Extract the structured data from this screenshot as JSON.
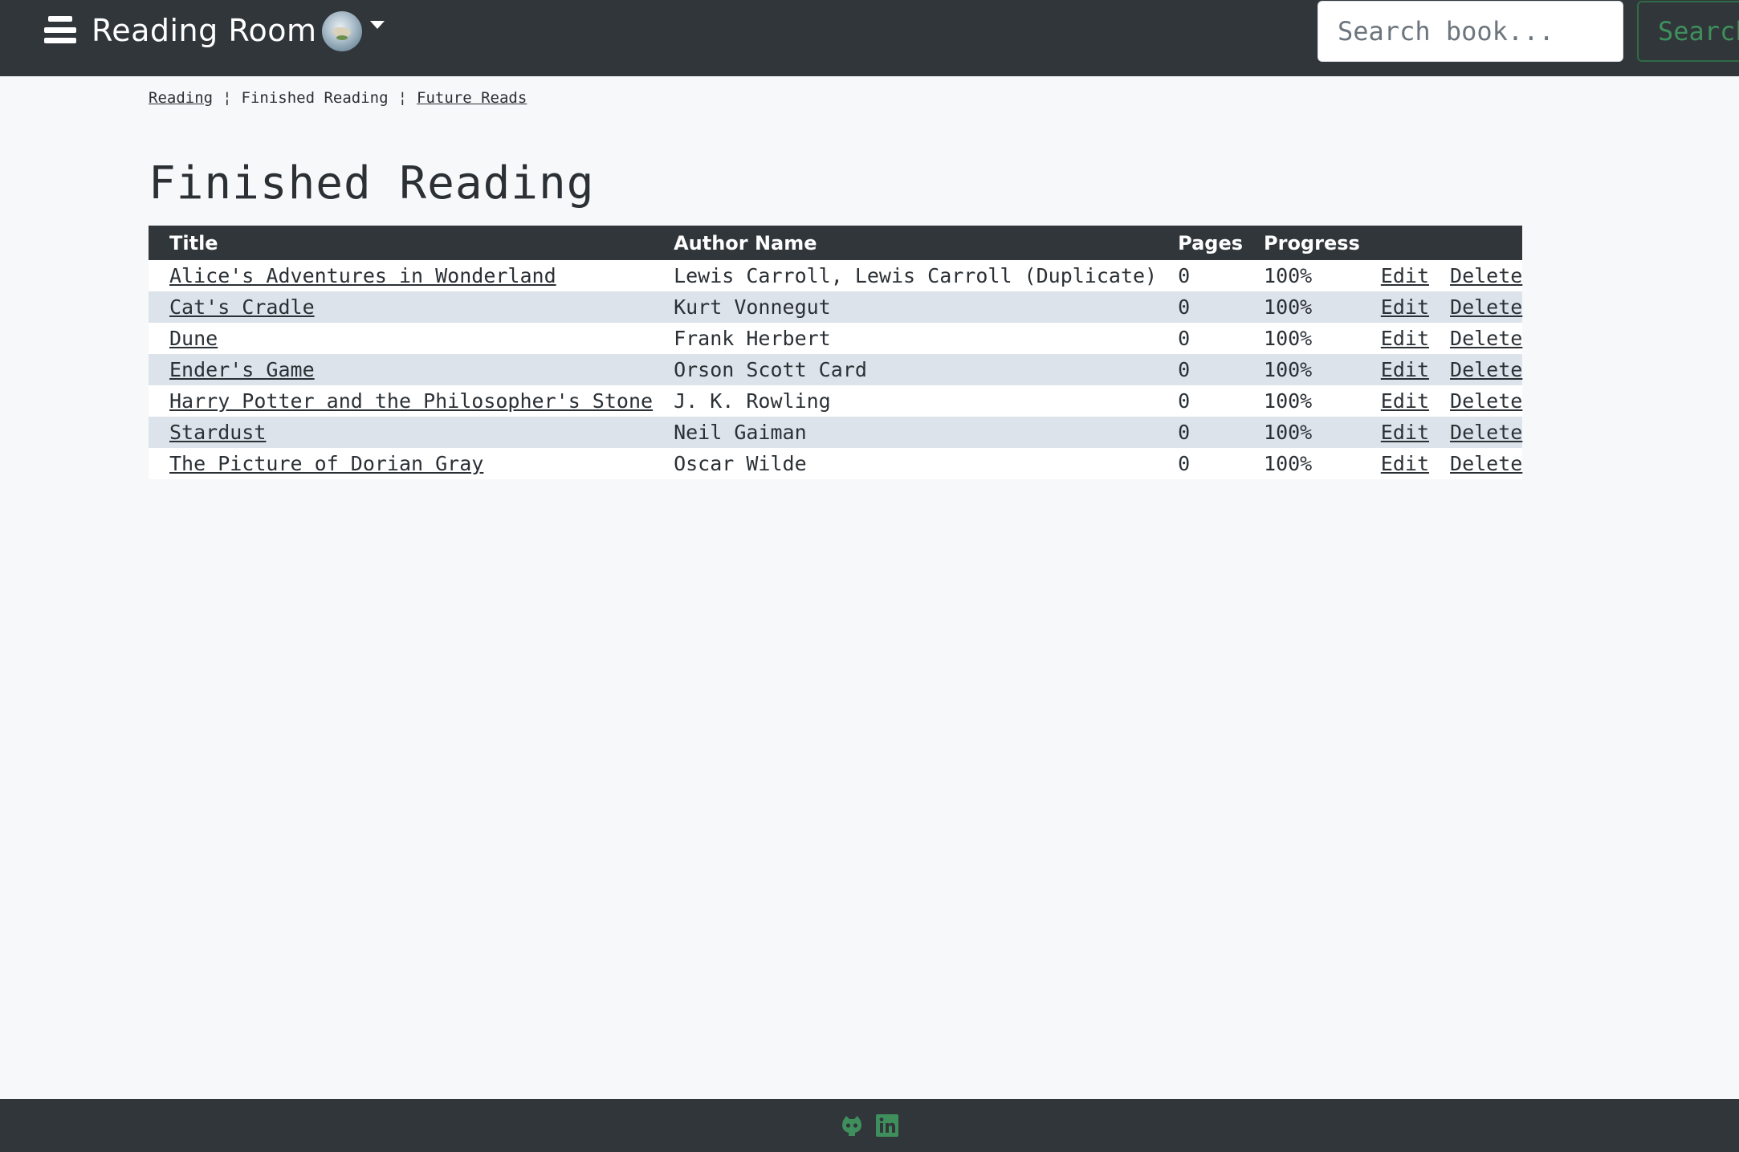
{
  "navbar": {
    "brand": "Reading Room",
    "search_placeholder": "Search book...",
    "search_button": "Search"
  },
  "breadcrumb": {
    "reading": "Reading",
    "separator": "¦",
    "finished": "Finished Reading",
    "future": "Future Reads"
  },
  "page_title": "Finished Reading",
  "table": {
    "headers": {
      "title": "Title",
      "author": "Author Name",
      "pages": "Pages",
      "progress": "Progress"
    },
    "rows": [
      {
        "title": "Alice's Adventures in Wonderland",
        "author": "Lewis Carroll, Lewis Carroll (Duplicate)",
        "pages": "0",
        "progress": "100%",
        "edit": "Edit",
        "delete": "Delete"
      },
      {
        "title": "Cat's Cradle",
        "author": "Kurt Vonnegut",
        "pages": "0",
        "progress": "100%",
        "edit": "Edit",
        "delete": "Delete"
      },
      {
        "title": "Dune",
        "author": "Frank Herbert",
        "pages": "0",
        "progress": "100%",
        "edit": "Edit",
        "delete": "Delete"
      },
      {
        "title": "Ender's Game",
        "author": "Orson Scott Card",
        "pages": "0",
        "progress": "100%",
        "edit": "Edit",
        "delete": "Delete"
      },
      {
        "title": "Harry Potter and the Philosopher's Stone",
        "author": "J. K. Rowling",
        "pages": "0",
        "progress": "100%",
        "edit": "Edit",
        "delete": "Delete"
      },
      {
        "title": "Stardust",
        "author": "Neil Gaiman",
        "pages": "0",
        "progress": "100%",
        "edit": "Edit",
        "delete": "Delete"
      },
      {
        "title": "The Picture of Dorian Gray",
        "author": "Oscar Wilde",
        "pages": "0",
        "progress": "100%",
        "edit": "Edit",
        "delete": "Delete"
      }
    ]
  },
  "footer": {
    "icons": [
      "github-icon",
      "linkedin-icon"
    ],
    "icon_color": "#3f8f5c"
  }
}
